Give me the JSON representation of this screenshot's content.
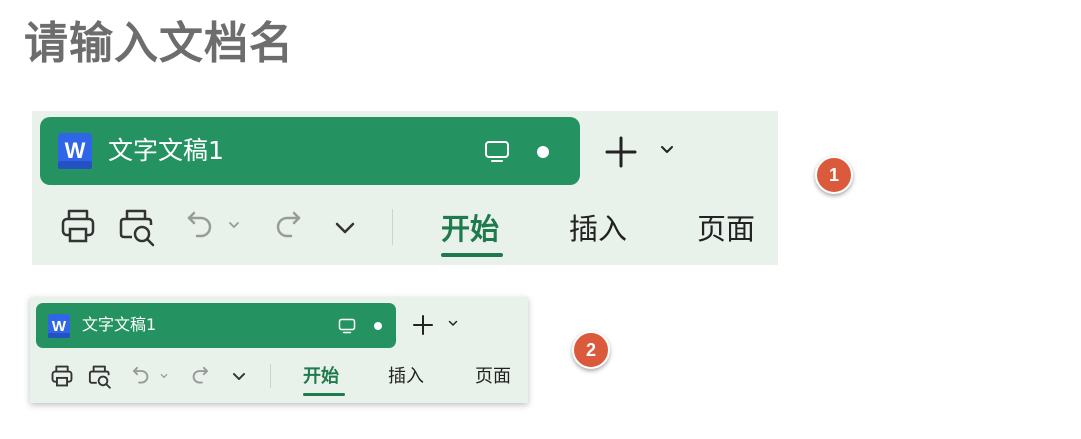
{
  "page": {
    "title": "请输入文档名"
  },
  "toolbar": {
    "doc_tab_title": "文字文稿1",
    "app_logo_letter": "W",
    "ribbon_tabs": [
      "开始",
      "插入",
      "页面"
    ],
    "active_tab": "开始",
    "icons": {
      "app_logo": "wps-writer-icon",
      "monitor": "monitor-icon",
      "unsaved_dot": "unsaved-dot",
      "new_tab": "plus-icon",
      "tab_menu": "chevron-down-icon",
      "print": "printer-icon",
      "print_preview": "print-preview-icon",
      "undo": "undo-icon",
      "undo_menu": "chevron-down-icon",
      "redo": "redo-icon",
      "more": "chevron-down-icon"
    }
  },
  "badges": [
    "1",
    "2"
  ],
  "colors": {
    "tab_green": "#249361",
    "panel_bg": "#e9f2ea",
    "active_tab_text": "#1f7a4d",
    "badge": "#db5a3c",
    "title_gray": "#6d6d6d"
  }
}
